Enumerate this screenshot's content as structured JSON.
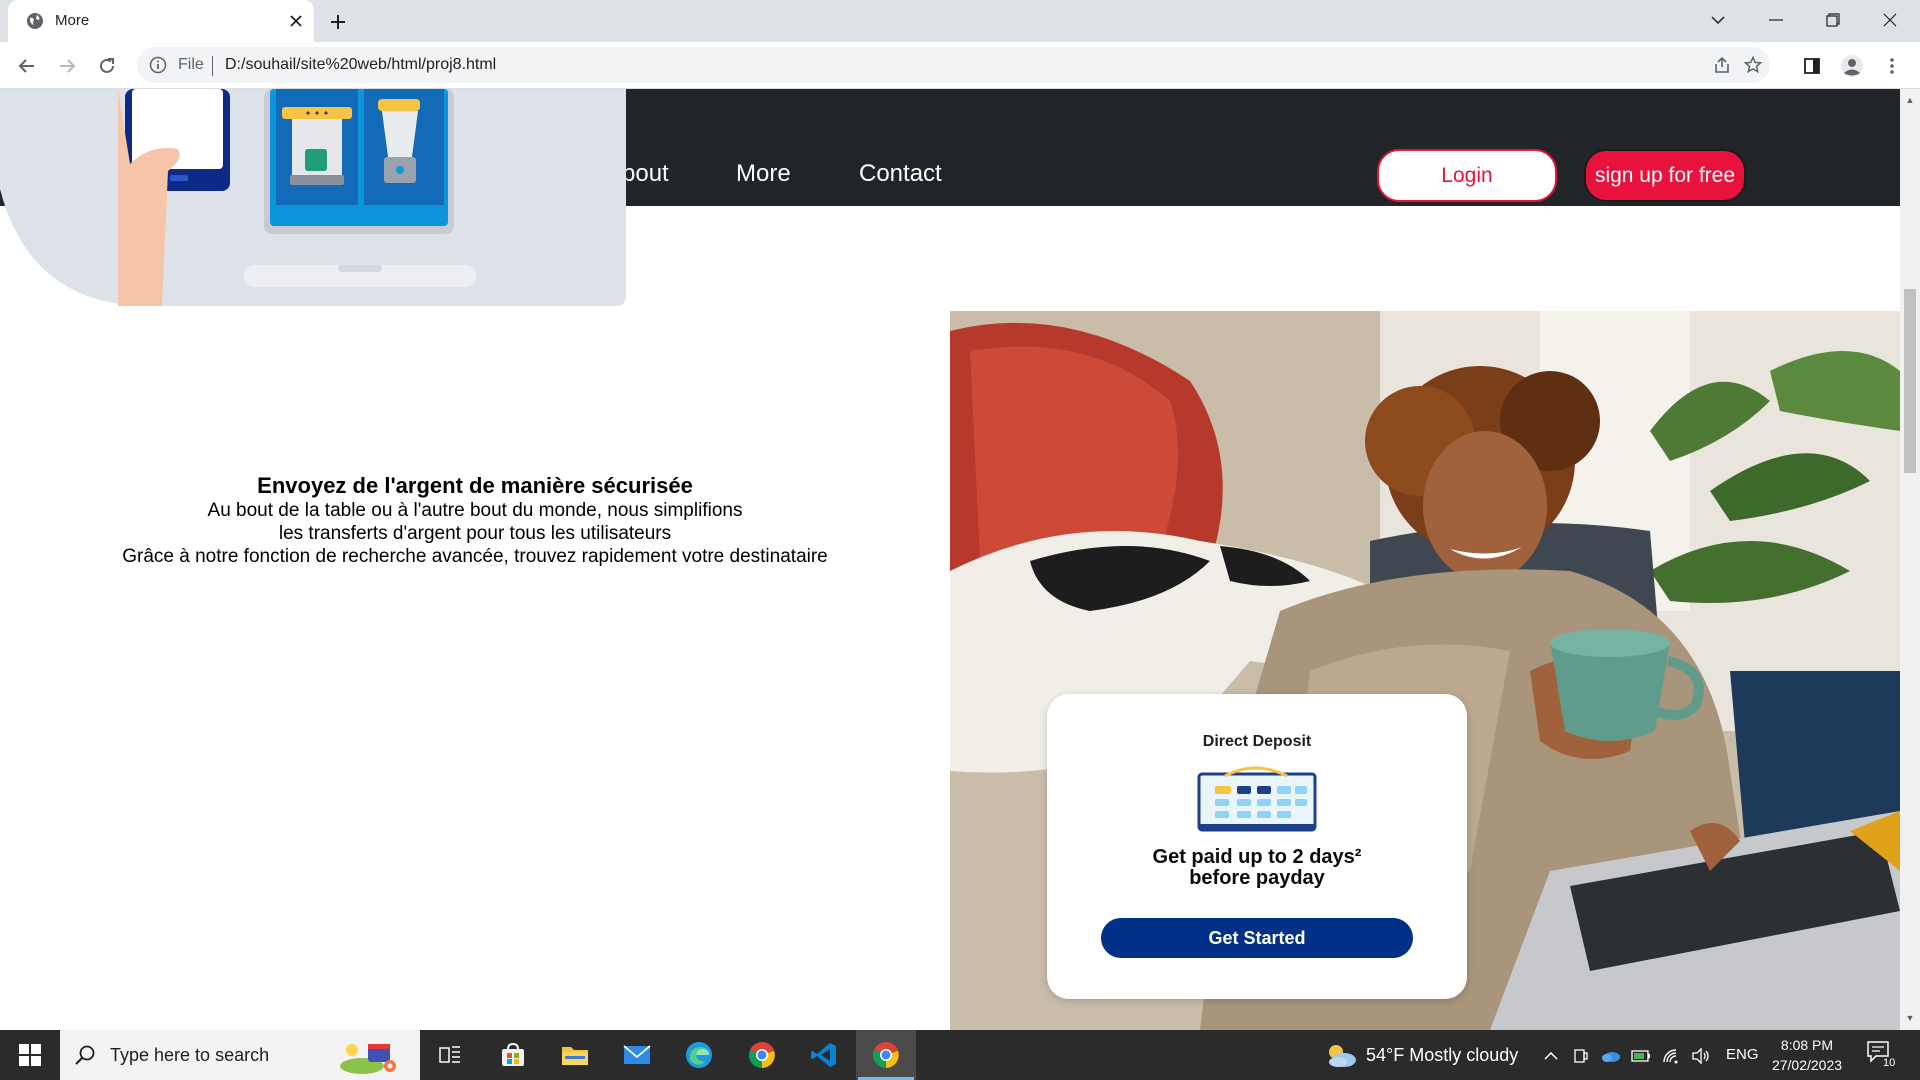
{
  "browser": {
    "tab_title": "More",
    "address_prefix": "File",
    "url": "D:/souhail/site%20web/html/proj8.html"
  },
  "nav": {
    "links": [
      "bout",
      "More",
      "Contact"
    ],
    "login_label": "Login",
    "signup_label": "sign up for free",
    "accent_color": "#e8133c",
    "background_color": "#212529"
  },
  "hero": {
    "title": "Envoyez de l'argent de manière sécurisée",
    "line1": "Au bout de la table ou à l'autre bout du monde, nous simplifions",
    "line2": "les transferts d'argent pour tous les utilisateurs",
    "line3": "Grâce à notre fonction de recherche avancée, trouvez rapidement votre destinataire"
  },
  "deposit_card": {
    "label": "Direct Deposit",
    "heading_line1": "Get paid up to 2 days²",
    "heading_line2": "before payday",
    "button_label": "Get Started",
    "button_color": "#003087"
  },
  "taskbar": {
    "search_placeholder": "Type here to search",
    "weather": "54°F  Mostly cloudy",
    "language": "ENG",
    "time": "8:08 PM",
    "date": "27/02/2023",
    "notification_count": "10"
  }
}
